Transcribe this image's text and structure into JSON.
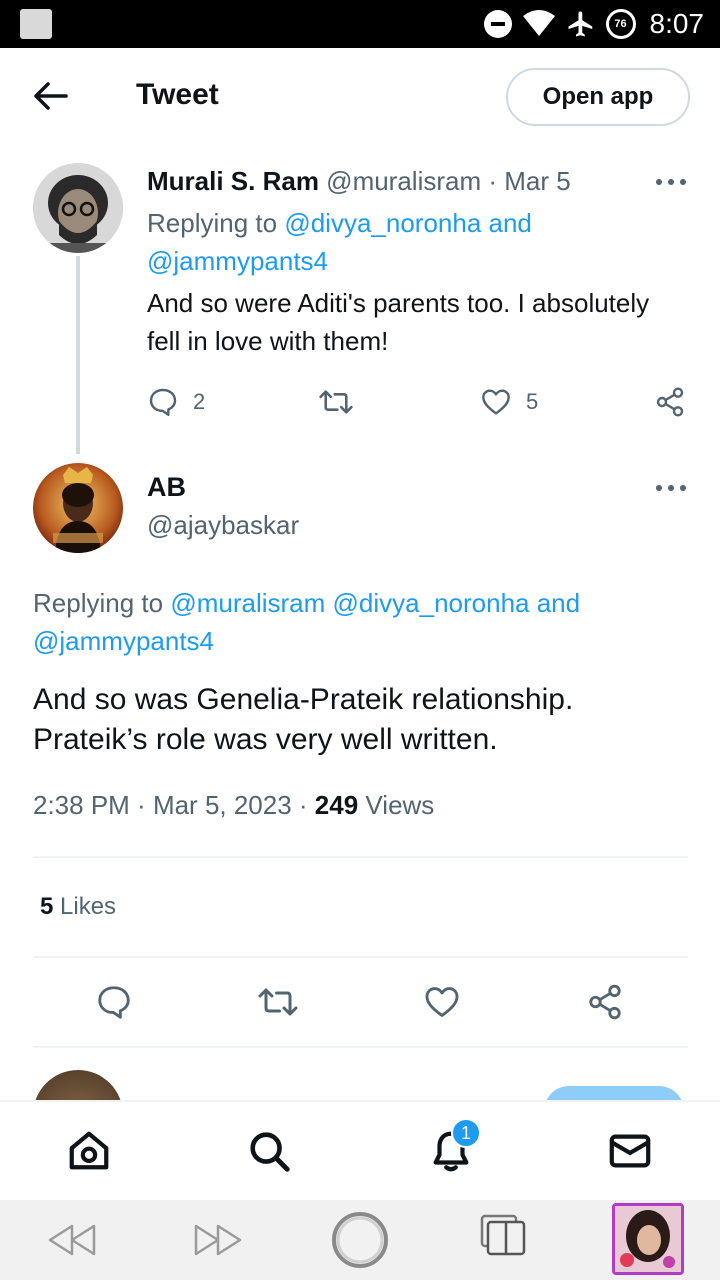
{
  "status_bar": {
    "time": "8:07",
    "battery": "76"
  },
  "header": {
    "title": "Tweet",
    "open_app": "Open app"
  },
  "reply_tweet": {
    "display_name": "Murali S. Ram",
    "handle_date": "@muralisram · Mar 5",
    "replying_prefix": "Replying to ",
    "replying_link_1": "@divya_noronha",
    "replying_and": " and",
    "replying_link_2": "@jammypants4",
    "text": "And so were Aditi's parents too. I absolutely fell in love with them!",
    "reply_count": "2",
    "like_count": "5"
  },
  "main_tweet": {
    "display_name": "AB",
    "handle": "@ajaybaskar",
    "replying_prefix": "Replying to ",
    "replying_link_1": "@muralisram",
    "replying_link_2": "@divya_noronha",
    "replying_and": " and",
    "replying_link_3": "@jammypants4",
    "text": "And so was Genelia-Prateik relationship. Prateik’s role was very well written.",
    "time": "2:38 PM",
    "date": "Mar 5, 2023",
    "views_count": "249",
    "views_label": "Views",
    "likes_count": "5",
    "likes_label": "Likes"
  },
  "bottom_nav": {
    "notification_badge": "1"
  },
  "colors": {
    "link": "#1d9bf0",
    "muted": "#536471",
    "text": "#0f1419",
    "border": "#cfd9de"
  }
}
